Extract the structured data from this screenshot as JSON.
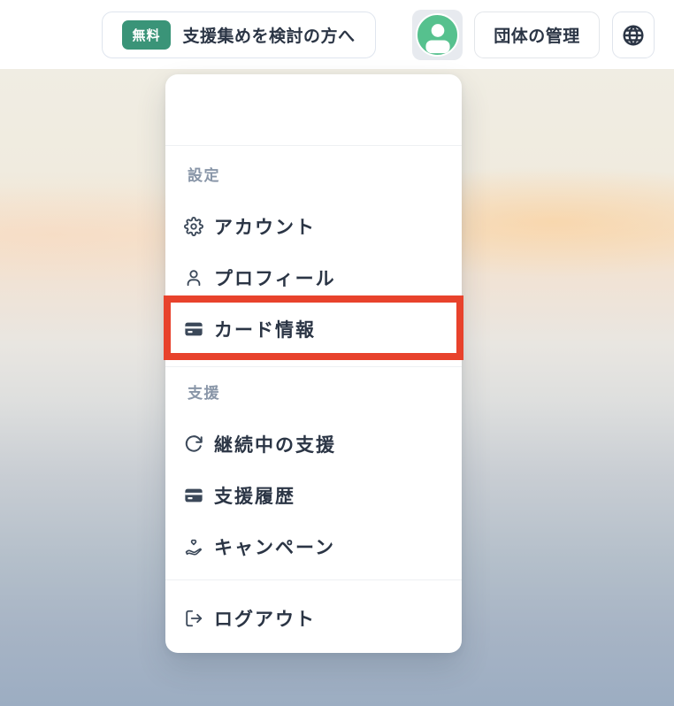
{
  "header": {
    "cta": {
      "badge": "無料",
      "label": "支援集めを検討の方へ"
    },
    "org_label": "団体の管理"
  },
  "menu": {
    "sections": [
      {
        "label": "設定",
        "items": [
          {
            "label": "アカウント",
            "icon": "gear-icon"
          },
          {
            "label": "プロフィール",
            "icon": "user-icon"
          },
          {
            "label": "カード情報",
            "icon": "credit-card-icon",
            "highlighted": true
          }
        ]
      },
      {
        "label": "支援",
        "items": [
          {
            "label": "継続中の支援",
            "icon": "refresh-icon"
          },
          {
            "label": "支援履歴",
            "icon": "credit-card-icon"
          },
          {
            "label": "キャンペーン",
            "icon": "hand-heart-icon"
          }
        ]
      }
    ],
    "logout_label": "ログアウト"
  },
  "colors": {
    "badge_green": "#3a9478",
    "avatar_green": "#56c18e",
    "highlight_red": "#e8422c",
    "text_dark": "#2b3545",
    "section_label_gray": "#8996a8"
  }
}
